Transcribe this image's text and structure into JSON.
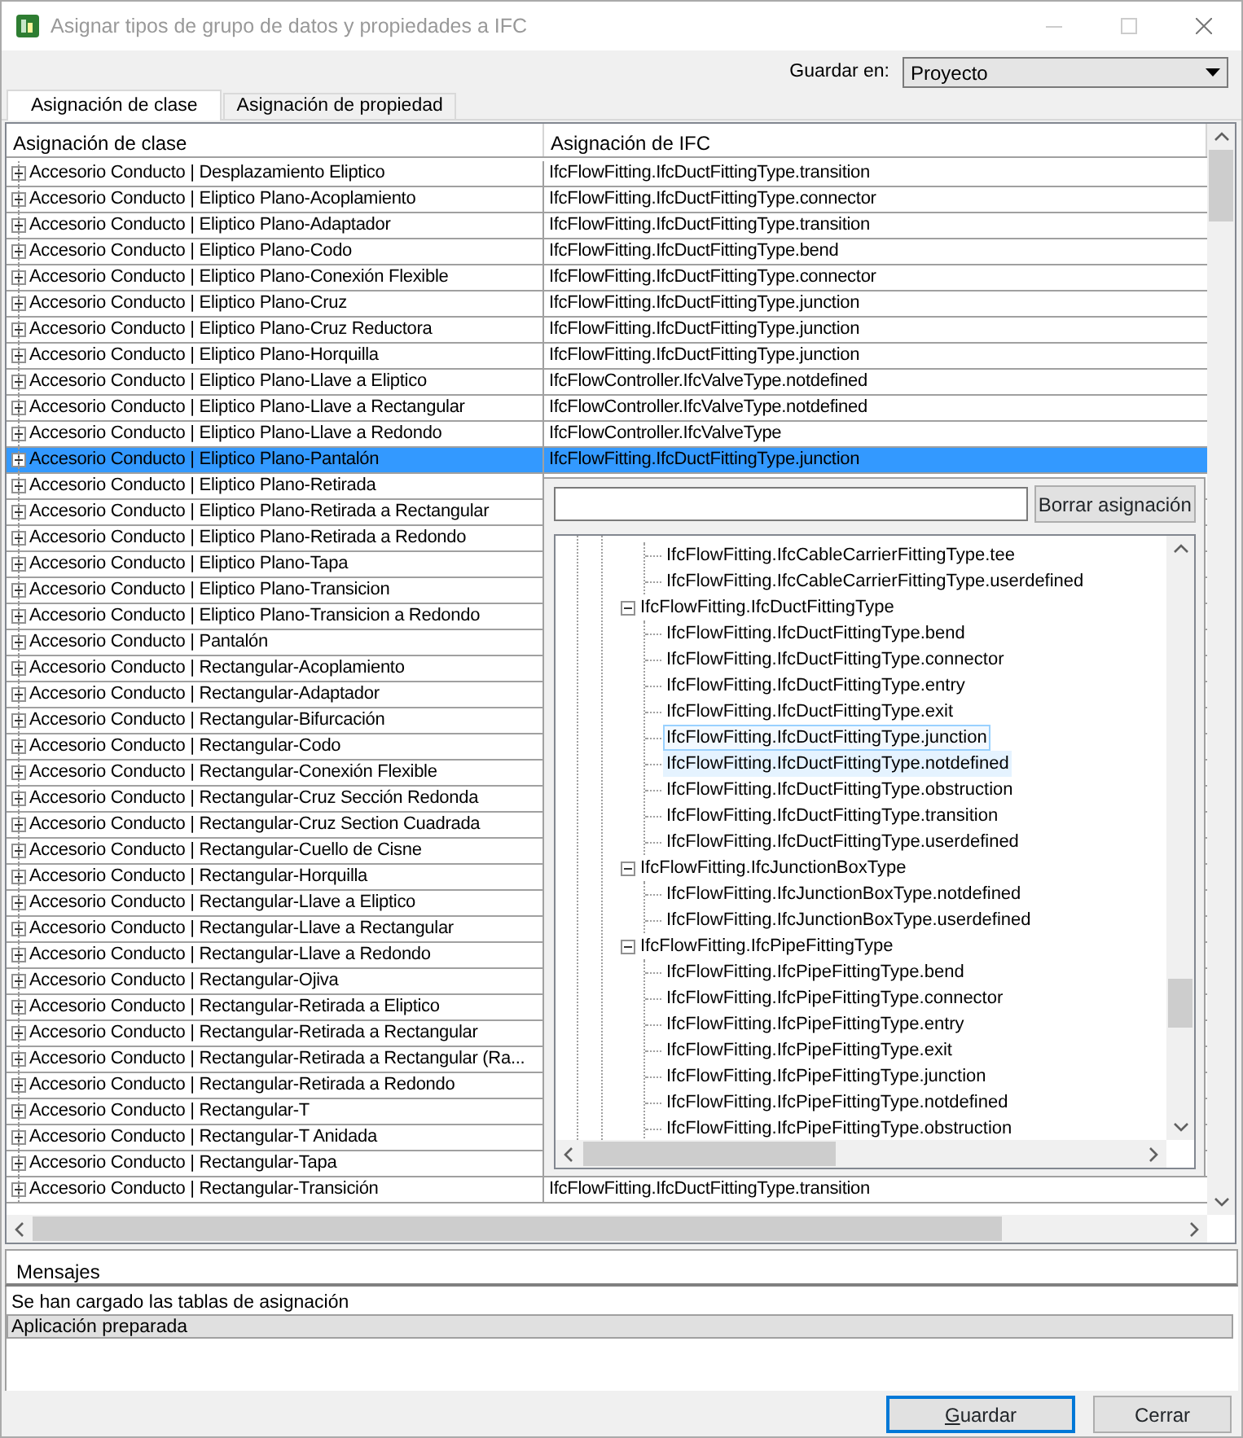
{
  "window": {
    "title": "Asignar tipos de grupo de datos y propiedades a IFC"
  },
  "save_in": {
    "label": "Guardar en:",
    "value": "Proyecto"
  },
  "tabs": [
    {
      "label": "Asignación de clase",
      "selected": true
    },
    {
      "label": "Asignación de propiedad",
      "selected": false
    }
  ],
  "grid": {
    "columns": [
      "Asignación de clase",
      "Asignación de IFC"
    ],
    "rows": [
      {
        "class": "Accesorio Conducto | Desplazamiento Eliptico",
        "ifc": "IfcFlowFitting.IfcDuctFittingType.transition",
        "expanded": false,
        "selected": false
      },
      {
        "class": "Accesorio Conducto | Eliptico Plano-Acoplamiento",
        "ifc": "IfcFlowFitting.IfcDuctFittingType.connector",
        "expanded": false,
        "selected": false
      },
      {
        "class": "Accesorio Conducto | Eliptico Plano-Adaptador",
        "ifc": "IfcFlowFitting.IfcDuctFittingType.transition",
        "expanded": false,
        "selected": false
      },
      {
        "class": "Accesorio Conducto | Eliptico Plano-Codo",
        "ifc": "IfcFlowFitting.IfcDuctFittingType.bend",
        "expanded": false,
        "selected": false
      },
      {
        "class": "Accesorio Conducto | Eliptico Plano-Conexión Flexible",
        "ifc": "IfcFlowFitting.IfcDuctFittingType.connector",
        "expanded": false,
        "selected": false
      },
      {
        "class": "Accesorio Conducto | Eliptico Plano-Cruz",
        "ifc": "IfcFlowFitting.IfcDuctFittingType.junction",
        "expanded": false,
        "selected": false
      },
      {
        "class": "Accesorio Conducto | Eliptico Plano-Cruz Reductora",
        "ifc": "IfcFlowFitting.IfcDuctFittingType.junction",
        "expanded": false,
        "selected": false
      },
      {
        "class": "Accesorio Conducto | Eliptico Plano-Horquilla",
        "ifc": "IfcFlowFitting.IfcDuctFittingType.junction",
        "expanded": false,
        "selected": false
      },
      {
        "class": "Accesorio Conducto | Eliptico Plano-Llave a Eliptico",
        "ifc": "IfcFlowController.IfcValveType.notdefined",
        "expanded": false,
        "selected": false
      },
      {
        "class": "Accesorio Conducto | Eliptico Plano-Llave a Rectangular",
        "ifc": "IfcFlowController.IfcValveType.notdefined",
        "expanded": false,
        "selected": false
      },
      {
        "class": "Accesorio Conducto | Eliptico Plano-Llave a Redondo",
        "ifc": "IfcFlowController.IfcValveType",
        "expanded": false,
        "selected": false
      },
      {
        "class": "Accesorio Conducto | Eliptico Plano-Pantalón",
        "ifc": "IfcFlowFitting.IfcDuctFittingType.junction",
        "expanded": false,
        "selected": true
      },
      {
        "class": "Accesorio Conducto | Eliptico Plano-Retirada",
        "expanded": false,
        "selected": false
      },
      {
        "class": "Accesorio Conducto | Eliptico Plano-Retirada a Rectangular",
        "expanded": false,
        "selected": false
      },
      {
        "class": "Accesorio Conducto | Eliptico Plano-Retirada a Redondo",
        "expanded": false,
        "selected": false
      },
      {
        "class": "Accesorio Conducto | Eliptico Plano-Tapa",
        "expanded": false,
        "selected": false
      },
      {
        "class": "Accesorio Conducto | Eliptico Plano-Transicion",
        "expanded": false,
        "selected": false
      },
      {
        "class": "Accesorio Conducto | Eliptico Plano-Transicion a Redondo",
        "expanded": false,
        "selected": false
      },
      {
        "class": "Accesorio Conducto | Pantalón",
        "expanded": false,
        "selected": false
      },
      {
        "class": "Accesorio Conducto | Rectangular-Acoplamiento",
        "expanded": false,
        "selected": false
      },
      {
        "class": "Accesorio Conducto | Rectangular-Adaptador",
        "expanded": false,
        "selected": false
      },
      {
        "class": "Accesorio Conducto | Rectangular-Bifurcación",
        "expanded": false,
        "selected": false
      },
      {
        "class": "Accesorio Conducto | Rectangular-Codo",
        "expanded": false,
        "selected": false
      },
      {
        "class": "Accesorio Conducto | Rectangular-Conexión Flexible",
        "expanded": false,
        "selected": false
      },
      {
        "class": "Accesorio Conducto | Rectangular-Cruz Sección Redonda",
        "expanded": false,
        "selected": false
      },
      {
        "class": "Accesorio Conducto | Rectangular-Cruz Section Cuadrada",
        "expanded": false,
        "selected": false
      },
      {
        "class": "Accesorio Conducto | Rectangular-Cuello de Cisne",
        "expanded": false,
        "selected": false
      },
      {
        "class": "Accesorio Conducto | Rectangular-Horquilla",
        "expanded": false,
        "selected": false
      },
      {
        "class": "Accesorio Conducto | Rectangular-Llave a Eliptico",
        "expanded": false,
        "selected": false
      },
      {
        "class": "Accesorio Conducto | Rectangular-Llave a Rectangular",
        "expanded": false,
        "selected": false
      },
      {
        "class": "Accesorio Conducto | Rectangular-Llave a Redondo",
        "expanded": false,
        "selected": false
      },
      {
        "class": "Accesorio Conducto | Rectangular-Ojiva",
        "expanded": false,
        "selected": false
      },
      {
        "class": "Accesorio Conducto | Rectangular-Retirada a Eliptico",
        "expanded": false,
        "selected": false
      },
      {
        "class": "Accesorio Conducto | Rectangular-Retirada a Rectangular",
        "expanded": false,
        "selected": false
      },
      {
        "class": "Accesorio Conducto | Rectangular-Retirada a Rectangular (Ra...",
        "expanded": false,
        "selected": false
      },
      {
        "class": "Accesorio Conducto | Rectangular-Retirada a Redondo",
        "expanded": false,
        "selected": false
      },
      {
        "class": "Accesorio Conducto | Rectangular-T",
        "expanded": false,
        "selected": false
      },
      {
        "class": "Accesorio Conducto | Rectangular-T Anidada",
        "expanded": false,
        "selected": false
      },
      {
        "class": "Accesorio Conducto | Rectangular-Tapa",
        "expanded": false,
        "selected": false
      },
      {
        "class": "Accesorio Conducto | Rectangular-Transición",
        "ifc": "IfcFlowFitting.IfcDuctFittingType.transition",
        "expanded": false,
        "selected": false
      }
    ]
  },
  "assignment_popup": {
    "button": "Borrar asignación",
    "tree": [
      {
        "children": [
          {
            "label": "IfcFlowFitting.IfcCableCarrierFittingType.tee",
            "selected": false,
            "hot": false
          },
          {
            "label": "IfcFlowFitting.IfcCableCarrierFittingType.userdefined",
            "selected": false,
            "hot": false
          }
        ]
      },
      {
        "label": "IfcFlowFitting.IfcDuctFittingType",
        "expanded": true,
        "children": [
          {
            "label": "IfcFlowFitting.IfcDuctFittingType.bend",
            "selected": false,
            "hot": false
          },
          {
            "label": "IfcFlowFitting.IfcDuctFittingType.connector",
            "selected": false,
            "hot": false
          },
          {
            "label": "IfcFlowFitting.IfcDuctFittingType.entry",
            "selected": false,
            "hot": false
          },
          {
            "label": "IfcFlowFitting.IfcDuctFittingType.exit",
            "selected": false,
            "hot": false
          },
          {
            "label": "IfcFlowFitting.IfcDuctFittingType.junction",
            "selected": true,
            "hot": false
          },
          {
            "label": "IfcFlowFitting.IfcDuctFittingType.notdefined",
            "selected": false,
            "hot": true
          },
          {
            "label": "IfcFlowFitting.IfcDuctFittingType.obstruction",
            "selected": false,
            "hot": false
          },
          {
            "label": "IfcFlowFitting.IfcDuctFittingType.transition",
            "selected": false,
            "hot": false
          },
          {
            "label": "IfcFlowFitting.IfcDuctFittingType.userdefined",
            "selected": false,
            "hot": false
          }
        ]
      },
      {
        "label": "IfcFlowFitting.IfcJunctionBoxType",
        "expanded": true,
        "children": [
          {
            "label": "IfcFlowFitting.IfcJunctionBoxType.notdefined",
            "selected": false,
            "hot": false
          },
          {
            "label": "IfcFlowFitting.IfcJunctionBoxType.userdefined",
            "selected": false,
            "hot": false
          }
        ]
      },
      {
        "label": "IfcFlowFitting.IfcPipeFittingType",
        "expanded": true,
        "children": [
          {
            "label": "IfcFlowFitting.IfcPipeFittingType.bend",
            "selected": false,
            "hot": false
          },
          {
            "label": "IfcFlowFitting.IfcPipeFittingType.connector",
            "selected": false,
            "hot": false
          },
          {
            "label": "IfcFlowFitting.IfcPipeFittingType.entry",
            "selected": false,
            "hot": false
          },
          {
            "label": "IfcFlowFitting.IfcPipeFittingType.exit",
            "selected": false,
            "hot": false
          },
          {
            "label": "IfcFlowFitting.IfcPipeFittingType.junction",
            "selected": false,
            "hot": false
          },
          {
            "label": "IfcFlowFitting.IfcPipeFittingType.notdefined",
            "selected": false,
            "hot": false
          },
          {
            "label": "IfcFlowFitting.IfcPipeFittingType.obstruction",
            "selected": false,
            "hot": false
          }
        ]
      }
    ]
  },
  "messages": {
    "title": "Mensajes",
    "items": [
      {
        "text": "Se han cargado las tablas de asignación",
        "selected": false
      },
      {
        "text": "Aplicación preparada",
        "selected": true
      }
    ]
  },
  "buttons": [
    {
      "label": "Guardar",
      "default": true
    },
    {
      "label": "Cerrar",
      "default": false
    }
  ]
}
